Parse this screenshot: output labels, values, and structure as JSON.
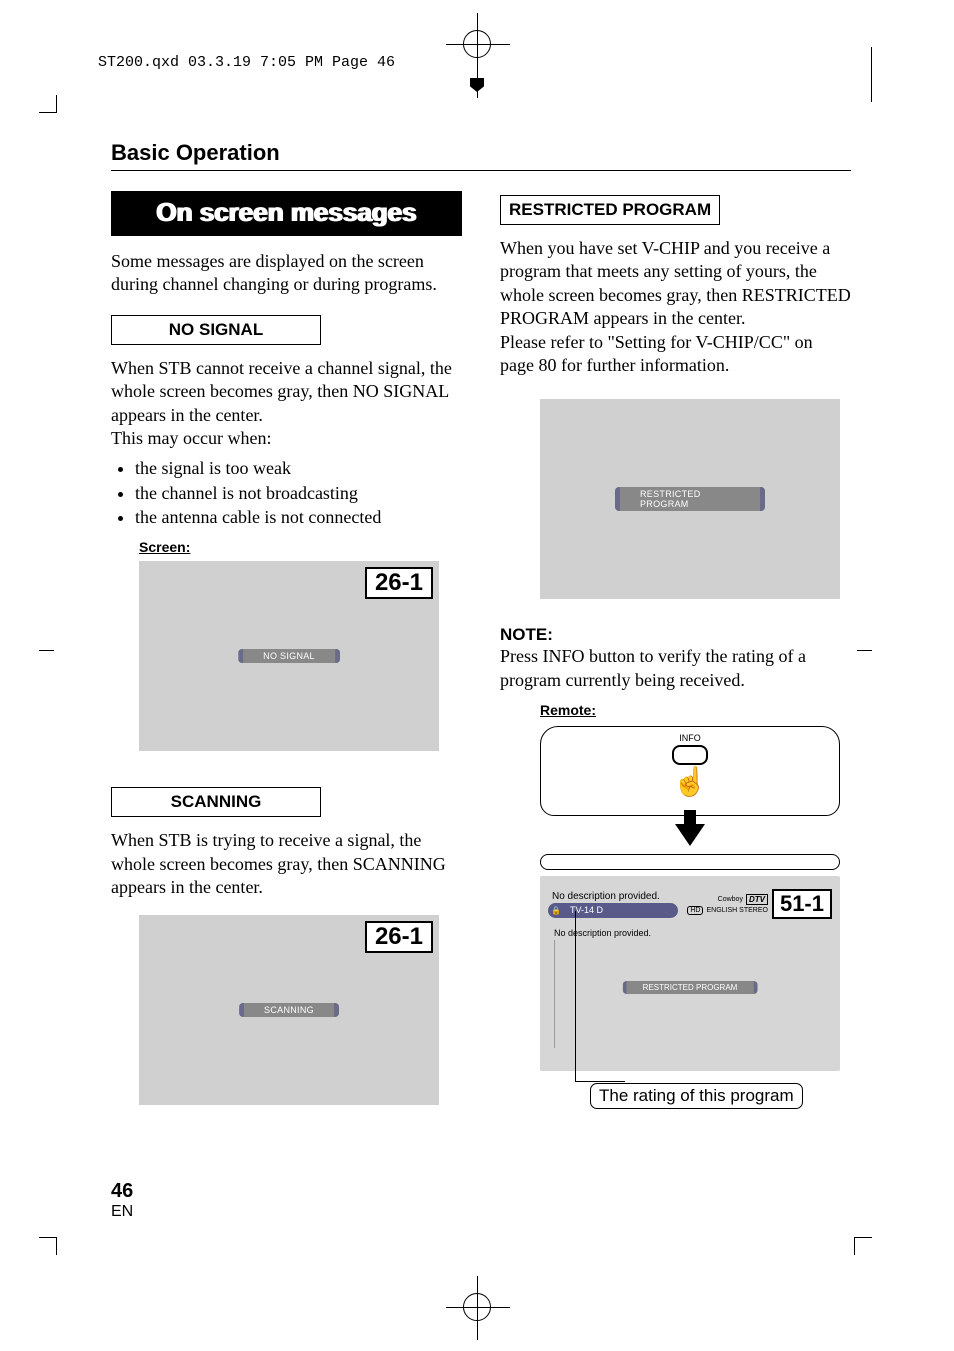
{
  "header_line": "ST200.qxd  03.3.19 7:05 PM  Page 46",
  "section_title": "Basic Operation",
  "banner_title": "On screen messages",
  "intro_text": "Some messages are displayed on the screen during channel changing or during programs.",
  "left": {
    "no_signal_heading": "NO SIGNAL",
    "no_signal_text": "When STB cannot receive a channel signal, the whole screen becomes gray, then NO SIGNAL appears in the center.\nThis may occur when:",
    "bullets": [
      "the signal is too weak",
      "the channel is not broadcasting",
      "the antenna cable is not connected"
    ],
    "screen_label": "Screen:",
    "screen1_channel": "26-1",
    "screen1_msg": "NO SIGNAL",
    "scanning_heading": "SCANNING",
    "scanning_text": "When STB is trying to receive a signal, the whole screen becomes gray, then SCANNING appears in the center.",
    "screen2_channel": "26-1",
    "screen2_msg": "SCANNING"
  },
  "right": {
    "restricted_heading": "RESTRICTED PROGRAM",
    "restricted_text": "When you have set V-CHIP and you receive a program that meets any setting of yours, the whole screen becomes gray, then RESTRICTED PROGRAM appears in the center.\nPlease refer to \"Setting for V-CHIP/CC\" on page 80 for further information.",
    "screen_msg": "RESTRICTED PROGRAM",
    "note_heading": "NOTE:",
    "note_text": "Press INFO button to verify the rating of a program currently being received.",
    "remote_label": "Remote:",
    "info_label": "INFO",
    "info_screen": {
      "title_line": "No description provided.",
      "rating": "TV-14 D",
      "show_name": "Cowboy",
      "dtv": "DTV",
      "hd": "HD",
      "audio": "ENGLISH STEREO",
      "channel": "51-1",
      "desc2": "No description provided.",
      "overlay_msg": "RESTRICTED PROGRAM"
    },
    "callout": "The rating of this program"
  },
  "page_number": "46",
  "page_lang": "EN"
}
